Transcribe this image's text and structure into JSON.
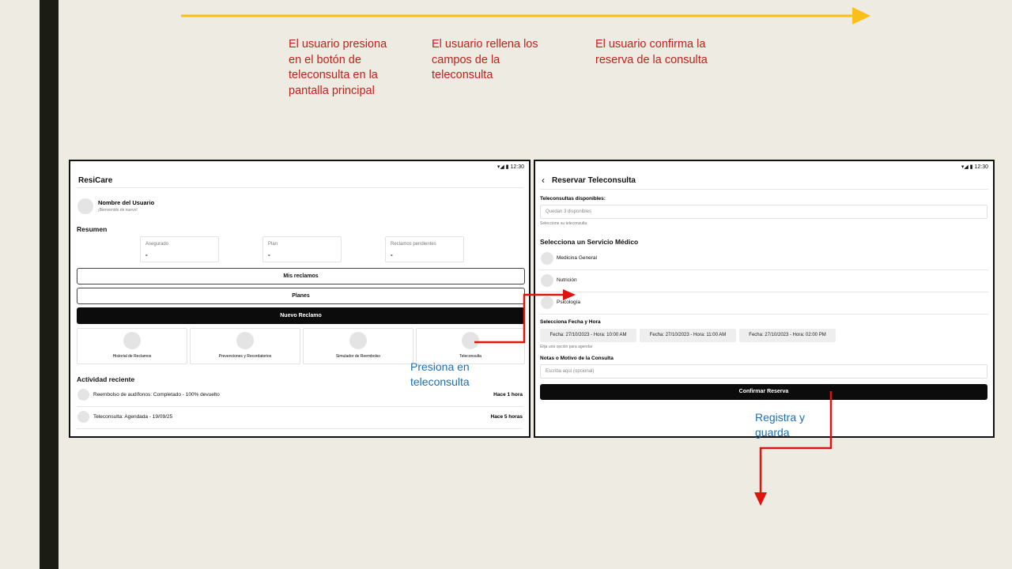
{
  "steps": [
    "El usuario presiona en el botón de teleconsulta en la pantalla principal",
    "El usuario rellena los campos de la teleconsulta",
    "El usuario confirma la reserva de la consulta"
  ],
  "notes": {
    "press": "Presiona en teleconsulta",
    "save": "Registra y guarda"
  },
  "colors": {
    "timeline": "#fbbf1b",
    "flow_arrow": "#e0140f",
    "step_text": "#c0221c",
    "note_text": "#1f6fb0"
  },
  "screen1": {
    "time": "12:30",
    "app_title": "ResiCare",
    "user_name": "Nombre del Usuario",
    "welcome": "¡Bienvenido de nuevo!",
    "summary_title": "Resumen",
    "summary_cards": [
      {
        "label": "Asegurado",
        "value": "-"
      },
      {
        "label": "Plan",
        "value": "-"
      },
      {
        "label": "Reclamos pendientes",
        "value": "-"
      }
    ],
    "buttons": {
      "mis_reclamos": "Mis reclamos",
      "planes": "Planes",
      "nuevo_reclamo": "Nuevo Reclamo"
    },
    "tiles": [
      "Historial de Reclamos",
      "Prevenciones y Recordatorios",
      "Simulador de Reembolso",
      "Teleconsulta"
    ],
    "activity_title": "Actividad reciente",
    "activities": [
      {
        "text": "Reembolso de audífonos: Completado - 100% devuelto",
        "time": "Hace 1 hora"
      },
      {
        "text": "Teleconsulta: Agendada - 19/09/25",
        "time": "Hace 5 horas"
      }
    ]
  },
  "screen2": {
    "time": "12:30",
    "title": "Reservar Teleconsulta",
    "available_label": "Teleconsultas disponibles:",
    "available_value": "Quedan 3 disponibles",
    "available_hint": "Seleccione su teleconsulta",
    "service_title": "Selecciona un Servicio Médico",
    "services": [
      "Medicina General",
      "Nutrición",
      "Psicología"
    ],
    "date_title": "Selecciona Fecha y Hora",
    "slots": [
      "Fecha: 27/10/2023 - Hora: 10:00 AM",
      "Fecha: 27/10/2023 - Hora: 11:00 AM",
      "Fecha: 27/10/2023 - Hora: 02:00 PM"
    ],
    "slot_hint": "Elija una opción para agendar",
    "notes_title": "Notas o Motivo de la Consulta",
    "notes_placeholder": "Escriba aquí (opcional)",
    "confirm": "Confirmar Reserva"
  }
}
